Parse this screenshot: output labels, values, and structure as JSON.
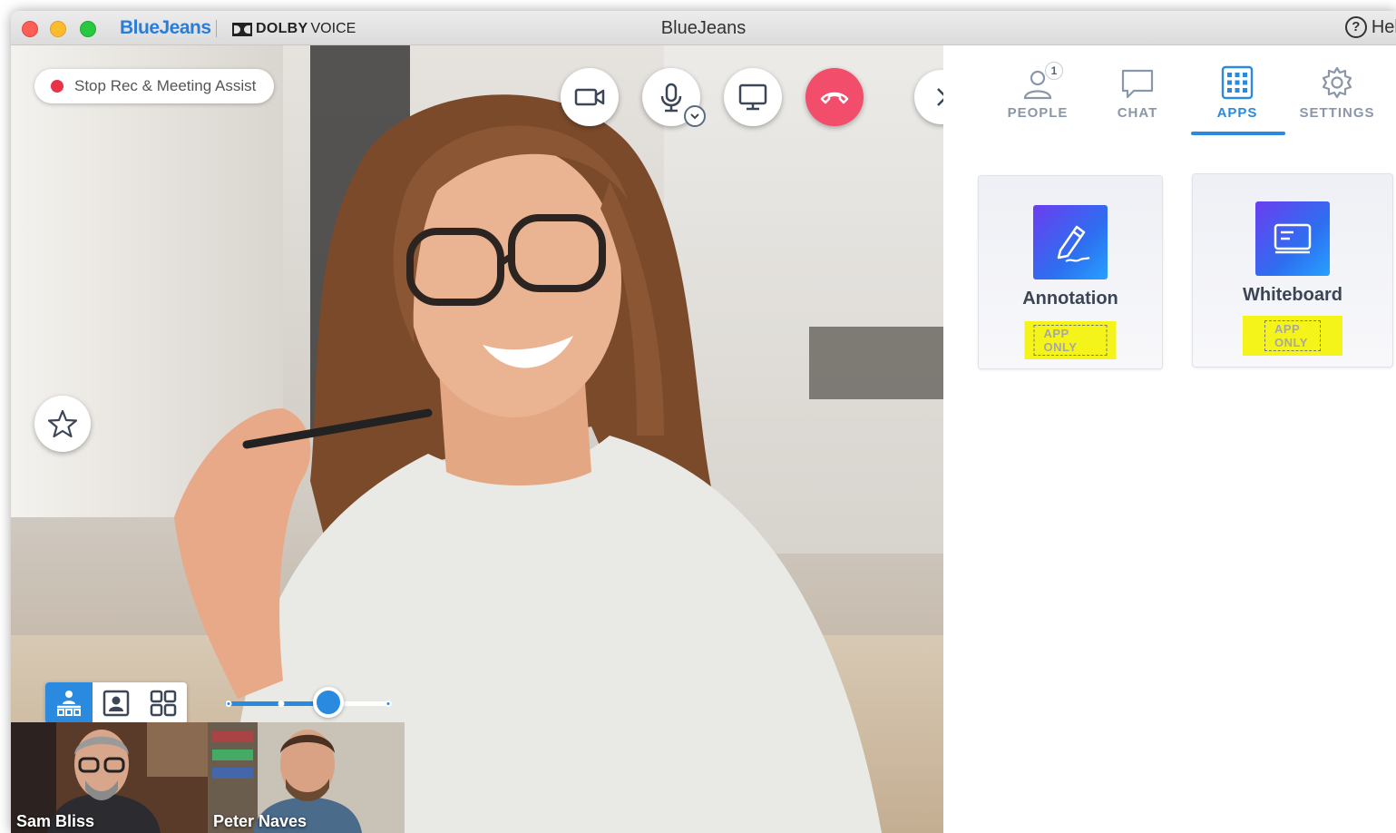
{
  "window": {
    "brand": "BlueJeans",
    "dolby_bold": "DOLBY",
    "dolby_light": "VOICE",
    "title": "BlueJeans",
    "help_label": "Help"
  },
  "video": {
    "recording_label": "Stop Rec & Meeting Assist",
    "volume_level": 0.62,
    "participants": [
      {
        "name": "Sam Bliss"
      },
      {
        "name": "Peter Naves"
      }
    ]
  },
  "panel": {
    "tabs": [
      {
        "label": "PEOPLE",
        "badge": "1"
      },
      {
        "label": "CHAT"
      },
      {
        "label": "APPS",
        "active": true
      },
      {
        "label": "SETTINGS"
      }
    ],
    "apps": [
      {
        "name": "Annotation",
        "tag": "APP ONLY"
      },
      {
        "name": "Whiteboard",
        "tag": "APP ONLY"
      }
    ]
  },
  "colors": {
    "accent": "#2a8ae0",
    "end_call": "#f24e6c",
    "highlight": "#f5f41a",
    "record": "#e8334a"
  }
}
